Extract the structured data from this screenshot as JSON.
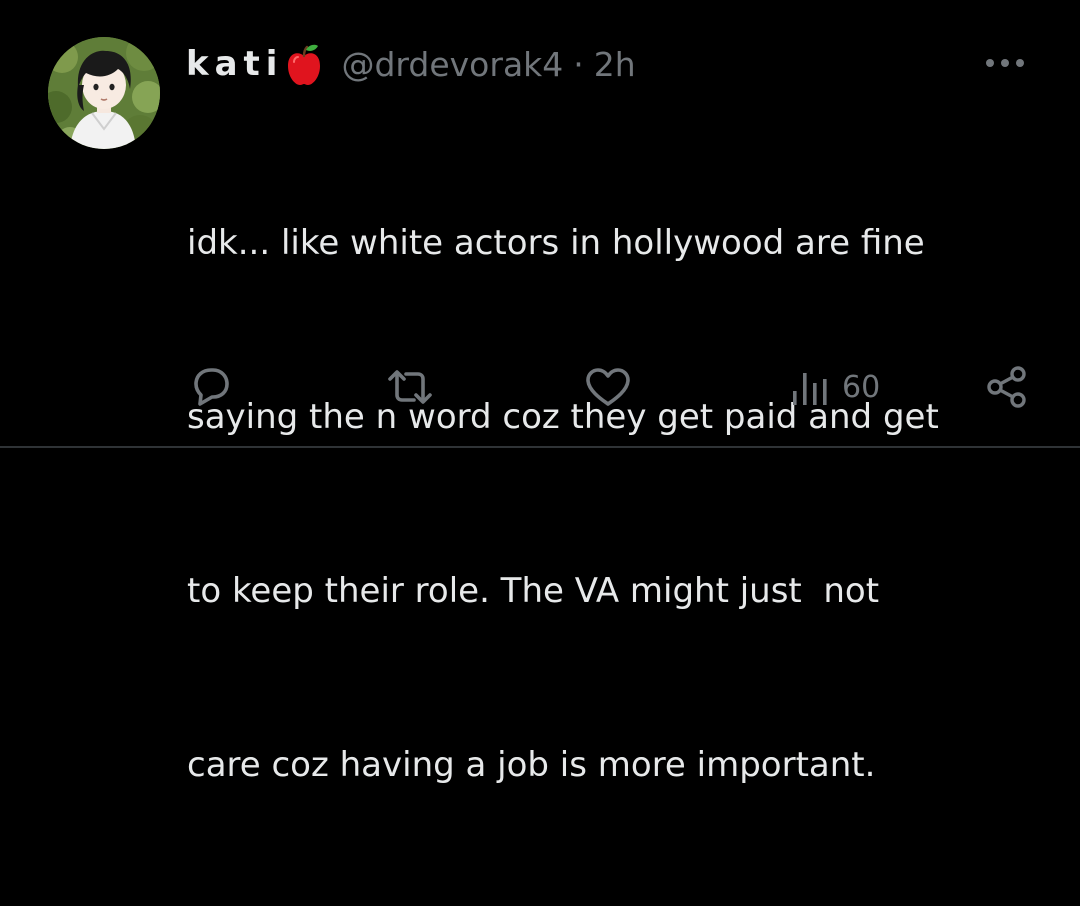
{
  "tweet": {
    "author": {
      "display_name": "kati",
      "badge_icon": "apple-icon",
      "handle": "@drdevorak4",
      "separator": "·",
      "time": "2h"
    },
    "more_icon": "more-icon",
    "text_lines": [
      "idk... like white actors in hollywood are fine",
      "saying the n word coz they get paid and get",
      "to keep their role. The VA might just  not",
      "care coz having a job is more important."
    ],
    "actions": {
      "reply_icon": "reply-icon",
      "retweet_icon": "retweet-icon",
      "like_icon": "like-icon",
      "views_icon": "views-icon",
      "views_count": "60",
      "share_icon": "share-icon"
    }
  },
  "colors": {
    "background": "#000000",
    "text_primary": "#e7e9ea",
    "text_secondary": "#71767b",
    "divider": "#2f3336",
    "apple_red": "#e0141e"
  }
}
